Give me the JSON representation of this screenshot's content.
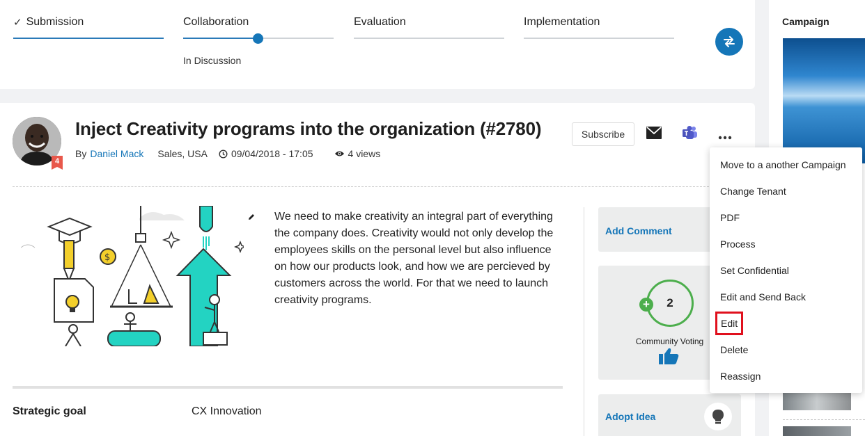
{
  "stages": [
    {
      "label": "Submission",
      "done": true
    },
    {
      "label": "Collaboration",
      "status": "In Discussion"
    },
    {
      "label": "Evaluation"
    },
    {
      "label": "Implementation"
    }
  ],
  "idea": {
    "title": "Inject Creativity programs into the organization (#2780)",
    "by_label": "By",
    "author": "Daniel Mack",
    "location": "Sales, USA",
    "date": "09/04/2018 - 17:05",
    "views": "4 views",
    "badge": "4",
    "subscribe_label": "Subscribe",
    "description": "We need to make creativity an integral part of everything the company does. Creativity would not only develop the employees skills on the personal level but also influence on how our products look, and how we are percieved by customers across the world. For that we need to launch creativity programs."
  },
  "details": {
    "strategic_goal_label": "Strategic goal",
    "strategic_goal_value": "CX Innovation"
  },
  "sidebar": {
    "add_comment": "Add Comment",
    "vote_count": "2",
    "vote_label": "Community Voting",
    "adopt_idea": "Adopt Idea"
  },
  "campaign": {
    "title": "Campaign"
  },
  "menu": {
    "items": [
      "Move to a another Campaign",
      "Change Tenant",
      "PDF",
      "Process",
      "Set Confidential",
      "Edit and Send Back",
      "Edit",
      "Delete",
      "Reassign"
    ],
    "highlighted": "Edit"
  },
  "colors": {
    "accent": "#1576b8",
    "vote_green": "#4cae4c",
    "highlight_red": "#e0101d"
  }
}
